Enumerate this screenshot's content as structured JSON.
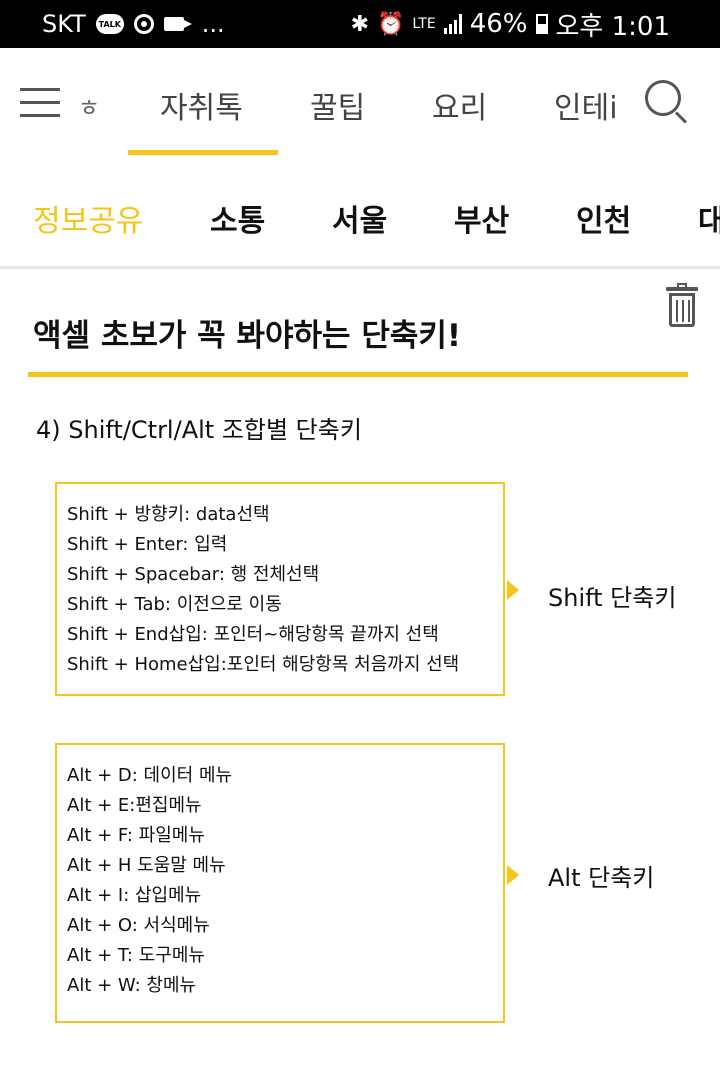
{
  "status_bar": {
    "carrier": "SKT",
    "talk_label": "TALK",
    "ellipsis": "...",
    "network": "LTE",
    "battery": "46%",
    "time": "오후 1:01"
  },
  "top_nav": {
    "partial_left": "ㅎ",
    "tabs": [
      "자취톡",
      "꿀팁",
      "요리",
      "인테i"
    ],
    "active_tab": "자취톡"
  },
  "categories": {
    "items": [
      "정보공유",
      "소통",
      "서울",
      "부산",
      "인천",
      "대"
    ],
    "active": "정보공유",
    "active_color": "#f5c518"
  },
  "post": {
    "title": "액셀 초보가 꼭 봐야하는 단축키!",
    "section_heading": "4) Shift/Ctrl/Alt 조합별 단축키",
    "shift_group": {
      "label": "Shift 단축키",
      "lines": [
        "Shift + 방향키: data선택",
        "Shift + Enter: 입력",
        "Shift + Spacebar: 행 전체선택",
        "Shift + Tab: 이전으로 이동",
        "Shift + End삽입: 포인터~해당항목 끝까지 선택",
        "Shift + Home삽입:포인터 해당항목 처음까지 선택"
      ]
    },
    "alt_group": {
      "label": "Alt 단축키",
      "lines": [
        "Alt + D: 데이터 메뉴",
        "Alt + E:편집메뉴",
        "Alt + F: 파일메뉴",
        "Alt + H 도움말 메뉴",
        "Alt + I: 삽입메뉴",
        "Alt + O: 서식메뉴",
        "Alt + T: 도구메뉴",
        "Alt + W: 창메뉴"
      ]
    }
  },
  "colors": {
    "accent": "#f5c518",
    "status_bar_bg": "#000000"
  },
  "icons": [
    "hamburger-menu-icon",
    "search-icon",
    "trash-icon"
  ]
}
